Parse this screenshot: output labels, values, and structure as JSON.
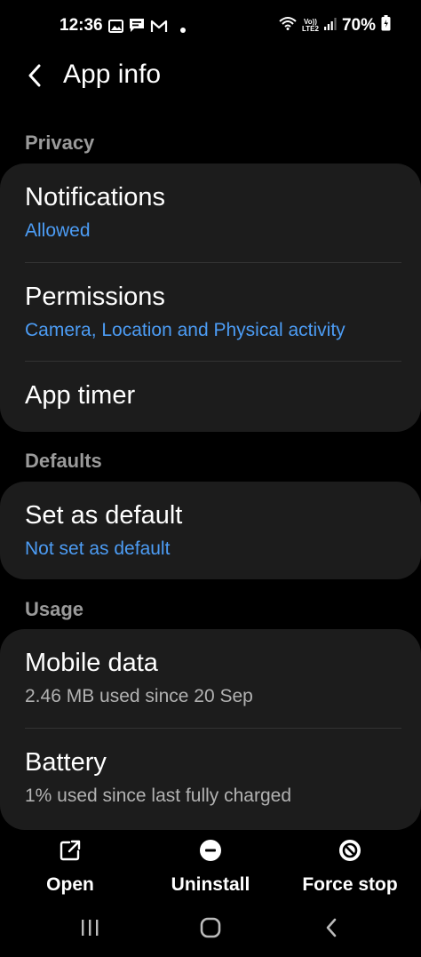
{
  "status_bar": {
    "time": "12:36",
    "network_top": "Vo))",
    "network_bottom": "LTE2",
    "battery": "70%"
  },
  "header": {
    "title": "App info",
    "back_icon": "chevron-left-icon"
  },
  "sections": {
    "privacy": {
      "label": "Privacy",
      "notifications": {
        "title": "Notifications",
        "subtitle": "Allowed"
      },
      "permissions": {
        "title": "Permissions",
        "subtitle": "Camera, Location and Physical activity"
      },
      "app_timer": {
        "title": "App timer"
      }
    },
    "defaults": {
      "label": "Defaults",
      "set_as_default": {
        "title": "Set as default",
        "subtitle": "Not set as default"
      }
    },
    "usage": {
      "label": "Usage",
      "mobile_data": {
        "title": "Mobile data",
        "subtitle": "2.46 MB used since 20 Sep"
      },
      "battery": {
        "title": "Battery",
        "subtitle": "1% used since last fully charged"
      }
    }
  },
  "actions": {
    "open": {
      "label": "Open",
      "icon": "open-external-icon"
    },
    "uninstall": {
      "label": "Uninstall",
      "icon": "minus-circle-icon"
    },
    "force_stop": {
      "label": "Force stop",
      "icon": "block-icon"
    }
  },
  "colors": {
    "background": "#000000",
    "card": "#1c1c1c",
    "accent_blue": "#4c9cf4",
    "section_gray": "#9a9a9a"
  }
}
